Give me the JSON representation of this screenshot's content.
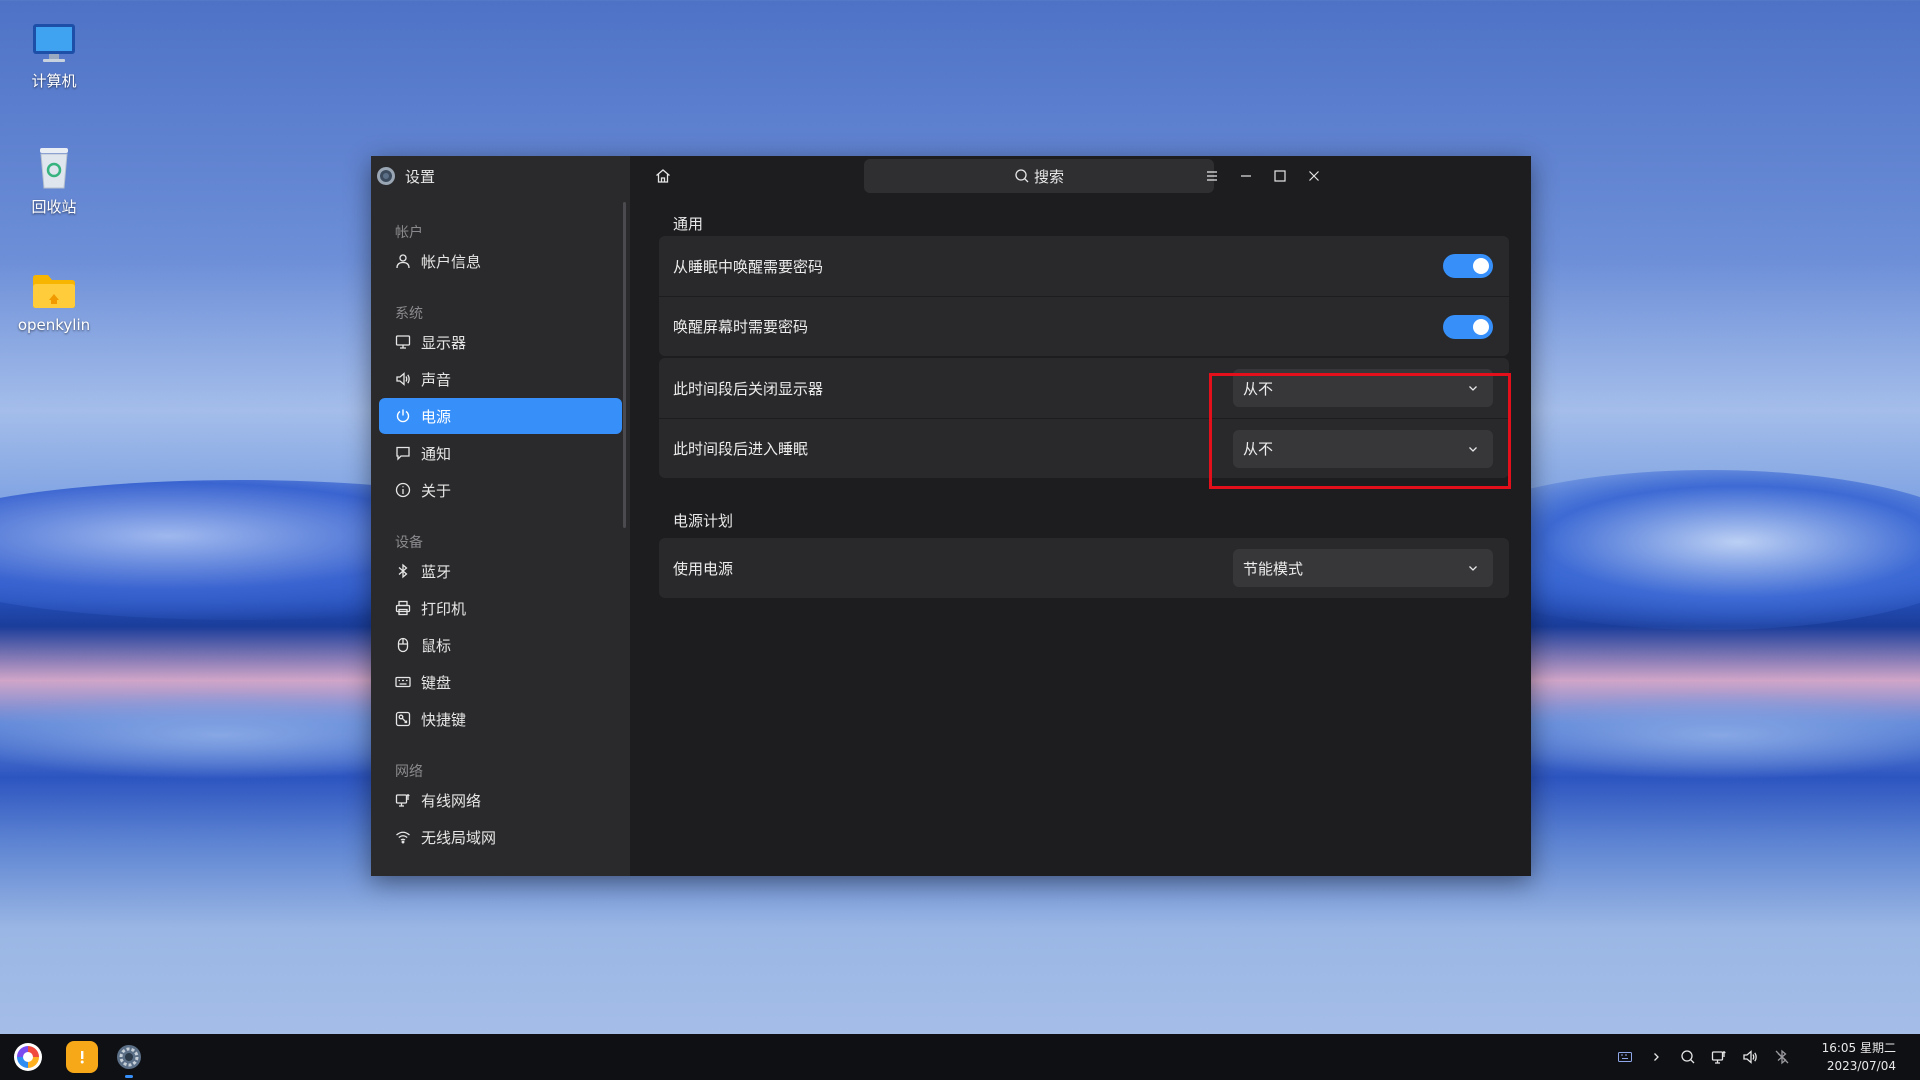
{
  "desktop": {
    "icons": [
      {
        "label": "计算机"
      },
      {
        "label": "回收站"
      },
      {
        "label": "openkylin"
      }
    ]
  },
  "window": {
    "title": "设置",
    "search_placeholder": "搜索",
    "sidebar": {
      "groups": [
        {
          "label": "帐户",
          "items": [
            {
              "label": "帐户信息",
              "icon": "user-icon"
            }
          ]
        },
        {
          "label": "系统",
          "items": [
            {
              "label": "显示器",
              "icon": "monitor-icon"
            },
            {
              "label": "声音",
              "icon": "speaker-icon"
            },
            {
              "label": "电源",
              "icon": "power-icon",
              "active": true
            },
            {
              "label": "通知",
              "icon": "notification-icon"
            },
            {
              "label": "关于",
              "icon": "info-icon"
            }
          ]
        },
        {
          "label": "设备",
          "items": [
            {
              "label": "蓝牙",
              "icon": "bluetooth-icon"
            },
            {
              "label": "打印机",
              "icon": "printer-icon"
            },
            {
              "label": "鼠标",
              "icon": "mouse-icon"
            },
            {
              "label": "键盘",
              "icon": "keyboard-icon"
            },
            {
              "label": "快捷键",
              "icon": "shortcut-icon"
            }
          ]
        },
        {
          "label": "网络",
          "items": [
            {
              "label": "有线网络",
              "icon": "wired-network-icon"
            },
            {
              "label": "无线局域网",
              "icon": "wifi-icon"
            }
          ]
        }
      ]
    },
    "general": {
      "title": "通用",
      "rows": [
        {
          "label": "从睡眠中唤醒需要密码",
          "toggle": true
        },
        {
          "label": "唤醒屏幕时需要密码",
          "toggle": true
        },
        {
          "label": "此时间段后关闭显示器",
          "value": "从不"
        },
        {
          "label": "此时间段后进入睡眠",
          "value": "从不"
        }
      ]
    },
    "power_plan": {
      "title": "电源计划",
      "rows": [
        {
          "label": "使用电源",
          "value": "节能模式"
        }
      ]
    }
  },
  "taskbar": {
    "time": "16:05 星期二",
    "date": "2023/07/04"
  },
  "colors": {
    "accent": "#3790fa",
    "highlight_box": "#e3101b"
  }
}
